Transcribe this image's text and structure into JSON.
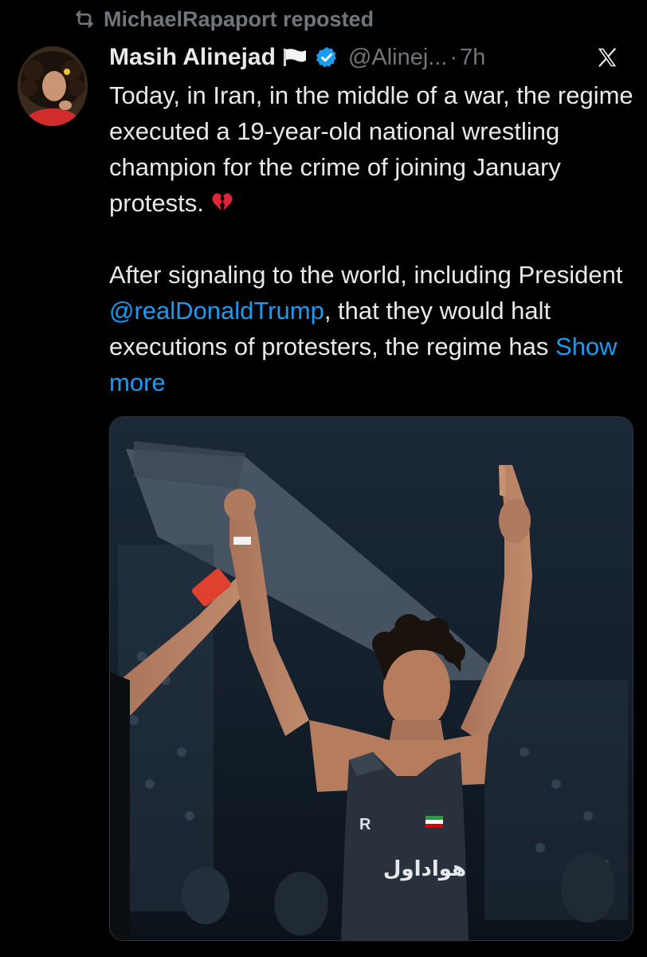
{
  "repost": {
    "icon": "repost-icon",
    "text": "MichaelRapaport reposted"
  },
  "author": {
    "name": "Masih Alinejad",
    "flag_icon": "white-flag-icon",
    "verified_icon": "verified-badge-icon",
    "verified_color": "#1d9bf0",
    "handle": "@Alinej...",
    "separator": "·",
    "time": "7h"
  },
  "close_icon": "x-close-icon",
  "post": {
    "p1": "Today, in Iran, in the middle of a war, the regime executed a 19-year-old national wrestling champion for the crime of joining January protests.",
    "p1_emoji": "broken-heart-icon",
    "p2_before": "After signaling to the world, including President ",
    "mention": "@realDonaldTrump",
    "p2_after": ", that they would halt executions of protesters, the regime has ",
    "show_more": "Show more"
  },
  "media": {
    "singlet_text": "هواداول",
    "singlet_logo": "R"
  },
  "colors": {
    "background": "#000000",
    "text": "#e7e9ea",
    "secondary": "#71767b",
    "link": "#1d9bf0"
  }
}
